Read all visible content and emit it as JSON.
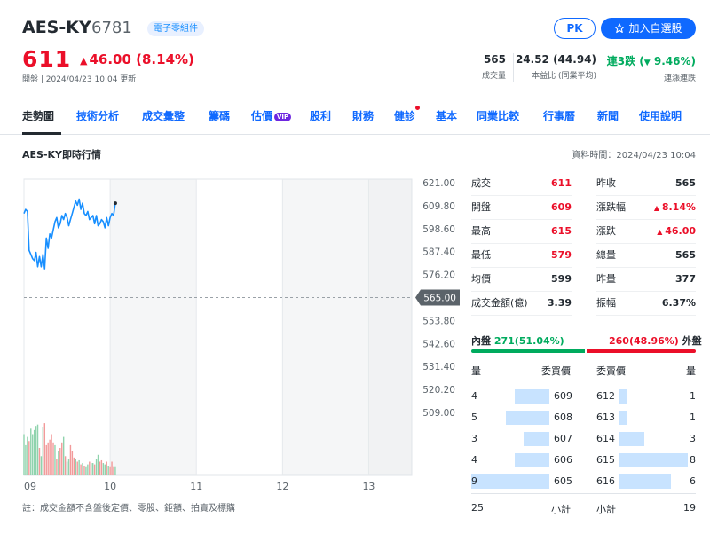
{
  "header": {
    "name": "AES-KY",
    "code": "6781",
    "category": "電子零組件",
    "pk_label": "PK",
    "watch_label": "加入自選股",
    "price": "611",
    "change": "46.00 (8.14%)",
    "open_time": "開盤 | 2024/04/23 10:04 更新",
    "stats": {
      "volume_value": "565",
      "volume_label": "成交量",
      "pe_value": "24.52 (44.94)",
      "pe_label": "本益比 (同業平均)",
      "streak_value": "連3跌",
      "streak_pct": "9.46%",
      "streak_label": "連漲連跌"
    }
  },
  "tabs": [
    "走勢圖",
    "技術分析",
    "成交彙整",
    "籌碼",
    "估價",
    "股利",
    "財務",
    "健診",
    "基本",
    "同業比較",
    "行事曆",
    "新聞",
    "使用說明"
  ],
  "tab_badges": {
    "vip": "VIP"
  },
  "section": {
    "title": "AES-KY即時行情",
    "data_time": "資料時間：2024/04/23 10:04"
  },
  "colors": {
    "accent": "#0f69ff",
    "up": "#eb0f29",
    "down": "#00ab5e",
    "line": "#188fff"
  },
  "quote": {
    "left": [
      {
        "k": "成交",
        "v": "611"
      },
      {
        "k": "開盤",
        "v": "609"
      },
      {
        "k": "最高",
        "v": "615"
      },
      {
        "k": "最低",
        "v": "579"
      },
      {
        "k": "均價",
        "v": "599"
      },
      {
        "k": "成交金額(億)",
        "v": "3.39"
      }
    ],
    "right": [
      {
        "k": "昨收",
        "v": "565"
      },
      {
        "k": "漲跌幅",
        "v": "8.14%"
      },
      {
        "k": "漲跌",
        "v": "46.00"
      },
      {
        "k": "總量",
        "v": "565"
      },
      {
        "k": "昨量",
        "v": "377"
      },
      {
        "k": "振幅",
        "v": "6.37%"
      }
    ]
  },
  "buy_sell": {
    "in_label": "內盤",
    "in_value": "271(51.04%)",
    "out_value": "260(48.96%)",
    "out_label": "外盤",
    "in_ratio": 0.5104
  },
  "orderbook": {
    "headers": {
      "bid_qty": "量",
      "bid_price": "委買價",
      "ask_price": "委賣價",
      "ask_qty": "量"
    },
    "bids": [
      {
        "qty": "4",
        "price": "609",
        "q": 4
      },
      {
        "qty": "5",
        "price": "608",
        "q": 5
      },
      {
        "qty": "3",
        "price": "607",
        "q": 3
      },
      {
        "qty": "4",
        "price": "606",
        "q": 4
      },
      {
        "qty": "9",
        "price": "605",
        "q": 9
      }
    ],
    "asks": [
      {
        "price": "612",
        "qty": "1",
        "q": 1
      },
      {
        "price": "613",
        "qty": "1",
        "q": 1
      },
      {
        "price": "614",
        "qty": "3",
        "q": 3
      },
      {
        "price": "615",
        "qty": "8",
        "q": 8
      },
      {
        "price": "616",
        "qty": "6",
        "q": 6
      }
    ],
    "bid_total": "25",
    "bid_total_label": "小計",
    "ask_total_label": "小計",
    "ask_total": "19"
  },
  "note": "註：成交金額不含盤後定價、零股、鉅額、拍賣及標購",
  "chart_data": {
    "type": "line",
    "title": "",
    "x_ticks": [
      "09",
      "10",
      "11",
      "12",
      "13"
    ],
    "y_ticks": [
      "621.00",
      "609.80",
      "598.60",
      "587.40",
      "576.20",
      "565.00",
      "553.80",
      "542.60",
      "531.40",
      "520.20",
      "509.00"
    ],
    "ylim": [
      509,
      621
    ],
    "reference_price": "565.00",
    "xlim_hours": [
      9.0,
      13.5
    ],
    "series": [
      {
        "x": [
          9.0,
          9.02,
          9.04,
          9.06,
          9.08,
          9.1,
          9.12,
          9.14,
          9.16,
          9.18,
          9.2,
          9.22,
          9.24,
          9.26,
          9.28,
          9.3,
          9.32,
          9.34,
          9.36,
          9.38,
          9.4,
          9.42,
          9.44,
          9.46,
          9.48,
          9.5,
          9.52,
          9.54,
          9.56,
          9.58,
          9.6,
          9.62,
          9.64,
          9.66,
          9.68,
          9.7,
          9.72,
          9.74,
          9.76,
          9.78,
          9.8,
          9.82,
          9.84,
          9.86,
          9.88,
          9.9,
          9.92,
          9.94,
          9.96,
          9.98,
          10.0,
          10.02,
          10.04,
          10.06
        ],
        "y": [
          606,
          608,
          607,
          588,
          586,
          584,
          583,
          587,
          580,
          585,
          580,
          586,
          579,
          594,
          589,
          596,
          594,
          598,
          602,
          604,
          599,
          601,
          605,
          603,
          606,
          604,
          600,
          603,
          606,
          609,
          612,
          610,
          613,
          608,
          611,
          606,
          605,
          607,
          603,
          604,
          605,
          601,
          605,
          600,
          601,
          603,
          602,
          599,
          604,
          600,
          604,
          606,
          605,
          611
        ]
      }
    ],
    "volume": {
      "x": [
        9.0,
        9.02,
        9.04,
        9.06,
        9.08,
        9.1,
        9.12,
        9.14,
        9.16,
        9.18,
        9.2,
        9.22,
        9.24,
        9.26,
        9.28,
        9.3,
        9.32,
        9.34,
        9.36,
        9.38,
        9.4,
        9.42,
        9.44,
        9.46,
        9.48,
        9.5,
        9.52,
        9.54,
        9.56,
        9.58,
        9.6,
        9.62,
        9.64,
        9.66,
        9.68,
        9.7,
        9.72,
        9.74,
        9.76,
        9.78,
        9.8,
        9.82,
        9.84,
        9.86,
        9.88,
        9.9,
        9.92,
        9.94,
        9.96,
        9.98,
        10.0,
        10.02,
        10.04,
        10.06
      ],
      "values": [
        30,
        22,
        28,
        25,
        34,
        30,
        33,
        36,
        37,
        20,
        14,
        35,
        38,
        22,
        24,
        26,
        30,
        24,
        22,
        12,
        18,
        20,
        24,
        28,
        14,
        10,
        12,
        22,
        18,
        13,
        12,
        10,
        11,
        8,
        9,
        7,
        6,
        8,
        10,
        9,
        9,
        8,
        12,
        15,
        10,
        11,
        9,
        8,
        10,
        7,
        6,
        10,
        6,
        6
      ],
      "direction": [
        "d",
        "d",
        "d",
        "u",
        "d",
        "d",
        "d",
        "d",
        "d",
        "u",
        "d",
        "d",
        "u",
        "u",
        "u",
        "u",
        "u",
        "u",
        "d",
        "u",
        "d",
        "u",
        "u",
        "d",
        "u",
        "d",
        "d",
        "u",
        "u",
        "u",
        "d",
        "u",
        "d",
        "u",
        "d",
        "u",
        "d",
        "d",
        "u",
        "d",
        "d",
        "u",
        "d",
        "d",
        "u",
        "u",
        "d",
        "d",
        "u",
        "d",
        "u",
        "u",
        "u",
        "d"
      ]
    }
  }
}
